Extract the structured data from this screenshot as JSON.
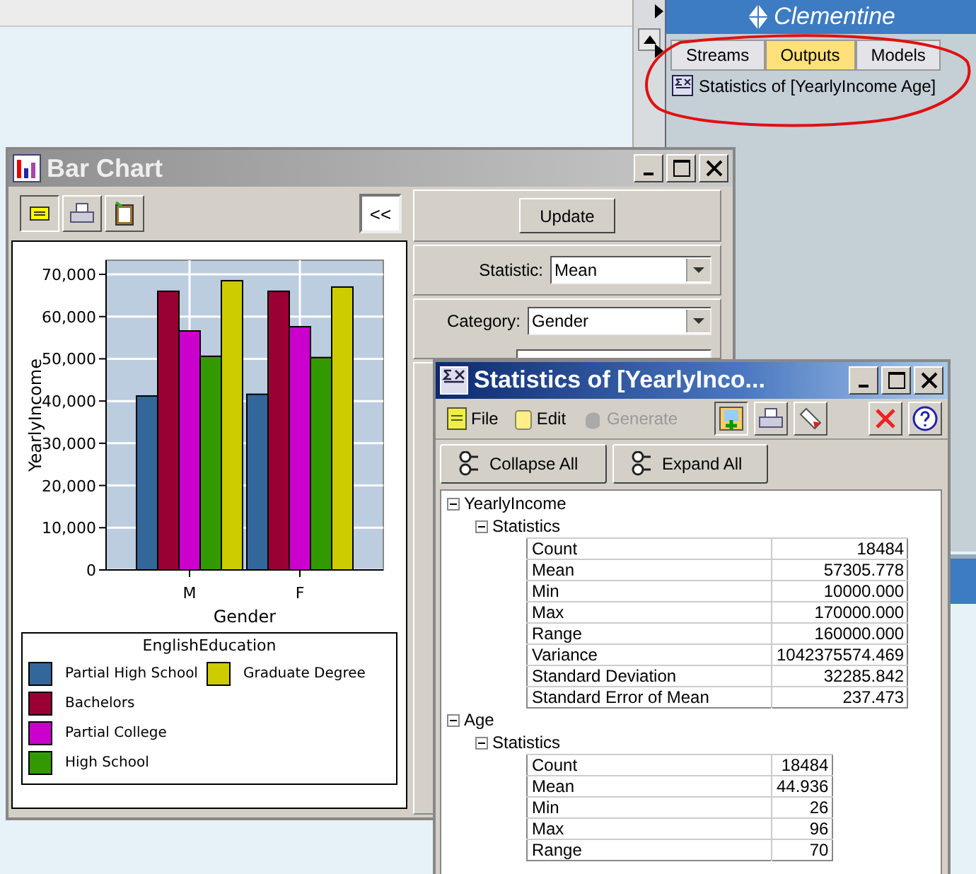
{
  "manager_panel": {
    "logo": "Clementine",
    "tabs": [
      {
        "label": "Streams",
        "selected": false
      },
      {
        "label": "Outputs",
        "selected": true
      },
      {
        "label": "Models",
        "selected": false
      }
    ],
    "outputs": [
      {
        "label": "Statistics of [YearlyIncome Age]"
      }
    ]
  },
  "bar_chart_window": {
    "title": "Bar Chart",
    "panel_toggle": "<<",
    "chart_data": {
      "type": "bar",
      "grid": true,
      "xlabel": "Gender",
      "ylabel": "YearlyIncome",
      "categories": [
        "M",
        "F"
      ],
      "ylim": [
        0,
        73350
      ],
      "yticks": [
        {
          "value": 0,
          "label": "0"
        },
        {
          "value": 10000,
          "label": "10,000"
        },
        {
          "value": 20000,
          "label": "20,000"
        },
        {
          "value": 30000,
          "label": "30,000"
        },
        {
          "value": 40000,
          "label": "40,000"
        },
        {
          "value": 50000,
          "label": "50,000"
        },
        {
          "value": 60000,
          "label": "60,000"
        },
        {
          "value": 70000,
          "label": "70,000"
        }
      ],
      "legend_title": "EnglishEducation",
      "series": [
        {
          "name": "Partial High School",
          "color": "#336699",
          "values": [
            41200,
            41600
          ]
        },
        {
          "name": "Bachelors",
          "color": "#990033",
          "values": [
            66000,
            66000
          ]
        },
        {
          "name": "Partial College",
          "color": "#cc00cc",
          "values": [
            56600,
            57600
          ]
        },
        {
          "name": "High School",
          "color": "#339900",
          "values": [
            50600,
            50300
          ]
        },
        {
          "name": "Graduate Degree",
          "color": "#cccc00",
          "values": [
            68500,
            67000
          ]
        }
      ]
    },
    "update_button": "Update",
    "statistic_label": "Statistic:",
    "statistic_value": "Mean",
    "category_label": "Category:",
    "category_value": "Gender"
  },
  "statistics_window": {
    "title": "Statistics of [YearlyInco...",
    "menus": [
      {
        "label": "File",
        "disabled": false
      },
      {
        "label": "Edit",
        "disabled": false
      },
      {
        "label": "Generate",
        "disabled": true
      }
    ],
    "buttons": [
      "Collapse All",
      "Expand All"
    ],
    "tree": [
      {
        "label": "YearlyIncome",
        "expanded": true,
        "children": [
          {
            "label": "Statistics",
            "expanded": true,
            "rows": [
              [
                "Count",
                "18484"
              ],
              [
                "Mean",
                "57305.778"
              ],
              [
                "Min",
                "10000.000"
              ],
              [
                "Max",
                "170000.000"
              ],
              [
                "Range",
                "160000.000"
              ],
              [
                "Variance",
                "1042375574.469"
              ],
              [
                "Standard Deviation",
                "32285.842"
              ],
              [
                "Standard Error of Mean",
                "237.473"
              ]
            ]
          }
        ]
      },
      {
        "label": "Age",
        "expanded": true,
        "children": [
          {
            "label": "Statistics",
            "expanded": true,
            "rows": [
              [
                "Count",
                "18484"
              ],
              [
                "Mean",
                "44.936"
              ],
              [
                "Min",
                "26"
              ],
              [
                "Max",
                "96"
              ],
              [
                "Range",
                "70"
              ]
            ]
          }
        ]
      }
    ]
  }
}
